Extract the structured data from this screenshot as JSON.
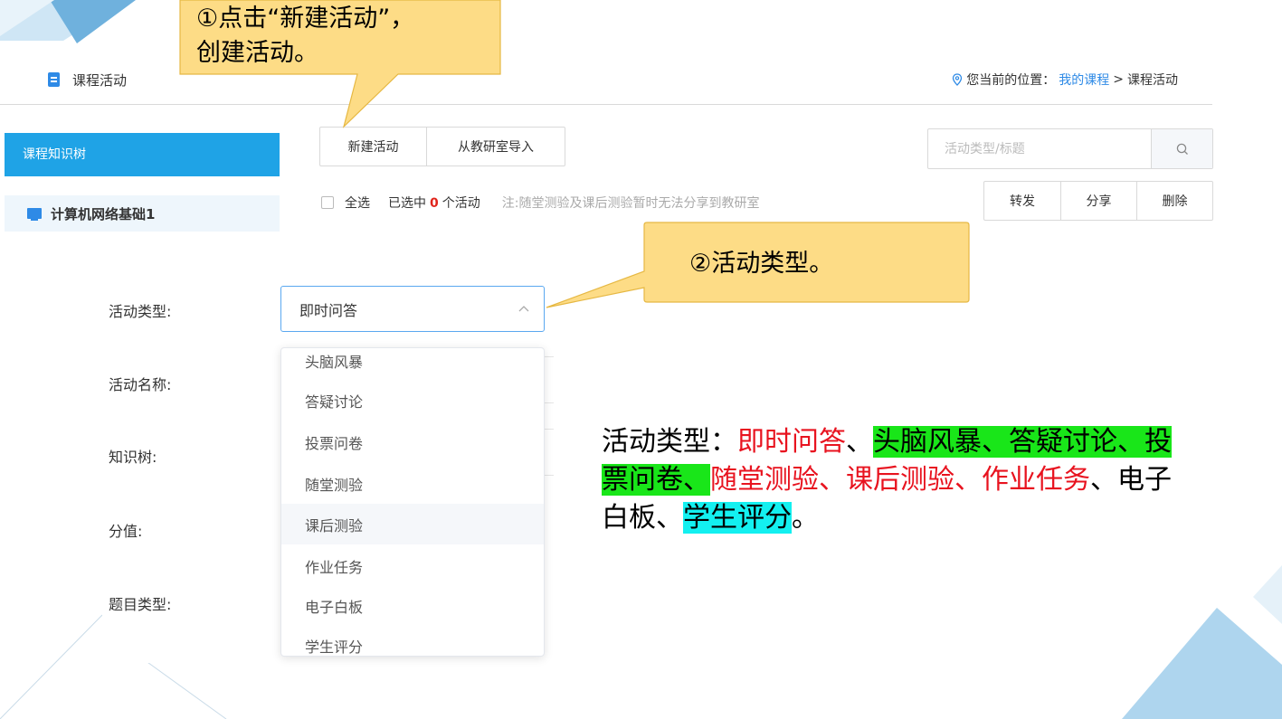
{
  "header": {
    "title": "课程活动",
    "location_label": "您当前的位置：",
    "crumb_link": "我的课程",
    "crumb_sep": ">",
    "crumb_current": "课程活动"
  },
  "sidebar": {
    "active_label": "课程知识树",
    "items": [
      {
        "label": "计算机网络基础1"
      }
    ]
  },
  "toolbar": {
    "new_label": "新建活动",
    "import_label": "从教研室导入",
    "search_placeholder": "活动类型/标题"
  },
  "selection": {
    "all_label": "全选",
    "prefix": "已选中",
    "count": "0",
    "suffix": "个活动",
    "note": "注:随堂测验及课后测验暂时无法分享到教研室"
  },
  "actions": [
    "转发",
    "分享",
    "删除"
  ],
  "form": {
    "labels": [
      "活动类型:",
      "活动名称:",
      "知识树:",
      "分值:",
      "题目类型:"
    ],
    "type_value": "即时问答",
    "dropdown_options": [
      "头脑风暴",
      "答疑讨论",
      "投票问卷",
      "随堂测验",
      "课后测验",
      "作业任务",
      "电子白板",
      "学生评分"
    ],
    "hovered_option": "课后测验"
  },
  "callouts": {
    "c1_line1": "①点击“新建活动”，",
    "c1_line2": "创建活动。",
    "c2": "②活动类型。"
  },
  "annotation": {
    "prefix": "活动类型：",
    "p1": "即时问答",
    "s1": "、",
    "p2": "头脑风暴、答疑讨论、投票问卷、",
    "p3": "随堂测验、课后测验、作业任务",
    "s2": "、电子白板、",
    "p4": "学生评分",
    "end": "。"
  },
  "colors": {
    "accent": "#1fa3e6",
    "link": "#2e8ae6",
    "callout_fill": "#fddc86",
    "callout_border": "#e6b843",
    "red_text": "#e8131f",
    "green_highlight": "#19e619",
    "cyan_highlight": "#13f0f0"
  },
  "icons": {
    "doc": "document-icon",
    "location": "location-pin-icon",
    "monitor": "monitor-icon",
    "search": "search-icon",
    "chevron": "chevron-up-icon"
  }
}
